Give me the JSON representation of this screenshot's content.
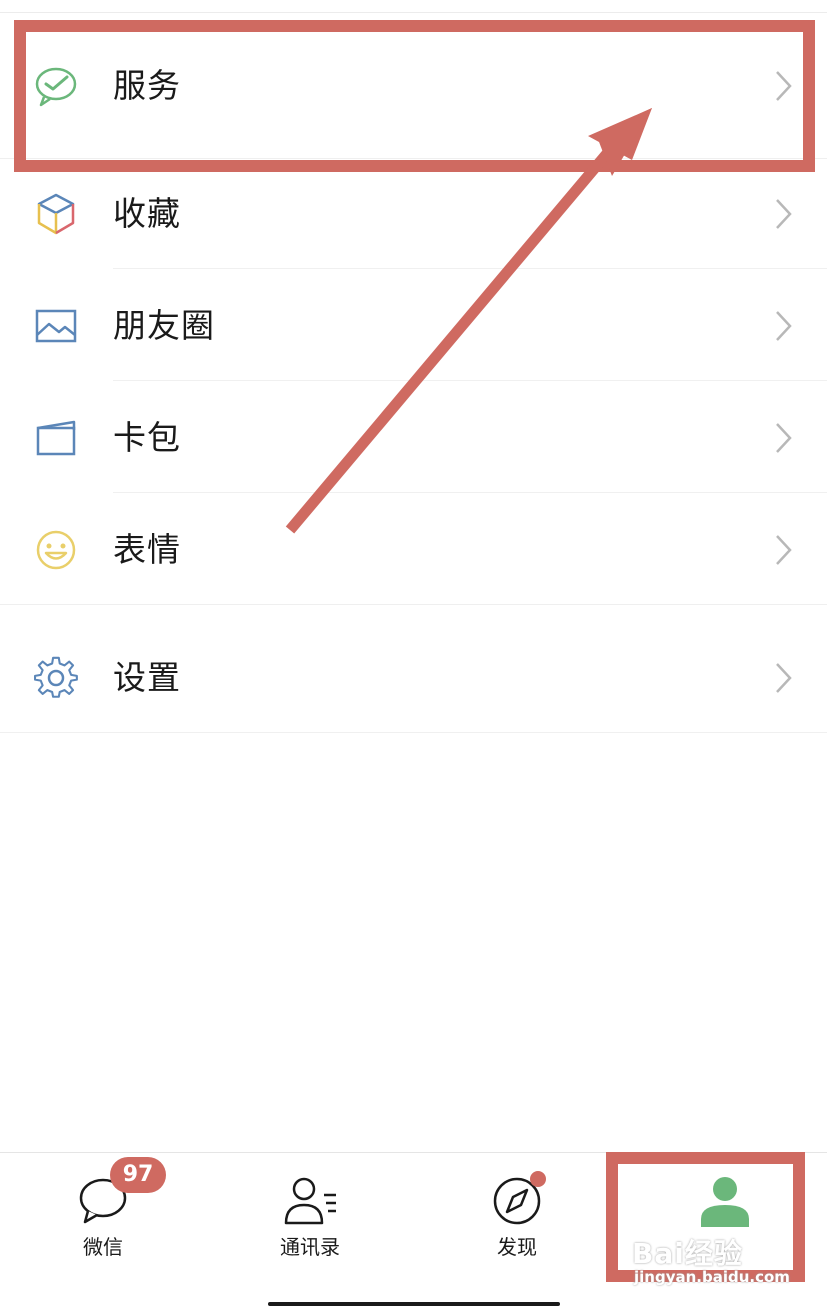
{
  "menu": {
    "items": [
      {
        "label": "服务",
        "icon": "wechat-pay-icon"
      },
      {
        "label": "收藏",
        "icon": "cube-icon"
      },
      {
        "label": "朋友圈",
        "icon": "image-icon"
      },
      {
        "label": "卡包",
        "icon": "card-icon"
      },
      {
        "label": "表情",
        "icon": "smiley-icon"
      },
      {
        "label": "设置",
        "icon": "gear-icon"
      }
    ]
  },
  "tabbar": {
    "tabs": [
      {
        "label": "微信",
        "icon": "chat-bubble-icon",
        "badge": "97"
      },
      {
        "label": "通讯录",
        "icon": "contacts-icon"
      },
      {
        "label": "发现",
        "icon": "compass-icon"
      },
      {
        "label": "",
        "icon": "person-icon",
        "active": true
      }
    ]
  },
  "watermark": {
    "logo": "Bai经验",
    "url": "jingyan.baidu.com"
  },
  "colors": {
    "annotation": "#cf6a61",
    "active_tab": "#6bb77b",
    "chevron": "#b8b8b8"
  }
}
